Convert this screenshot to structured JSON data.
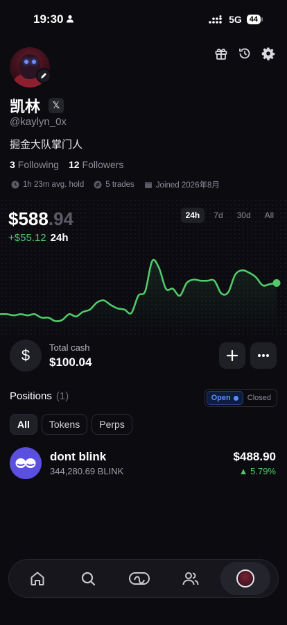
{
  "status_bar": {
    "time": "19:30",
    "network": "5G",
    "battery": "44"
  },
  "profile": {
    "name": "凯林",
    "handle": "@kaylyn_0x",
    "bio": "掘金大队掌门人",
    "following_count": "3",
    "following_label": "Following",
    "followers_count": "12",
    "followers_label": "Followers",
    "avg_hold": "1h 23m avg. hold",
    "trades": "5 trades",
    "joined": "Joined 2026年8月",
    "social_badge": "𝕏"
  },
  "top_icons": [
    "gift-icon",
    "history-icon",
    "settings-icon"
  ],
  "portfolio": {
    "balance_main": "$588",
    "balance_cents": ".94",
    "change": "+$55.12",
    "change_period": "24h",
    "ranges": [
      "24h",
      "7d",
      "30d",
      "All"
    ],
    "active_range": "24h",
    "accent_color": "#52c96a"
  },
  "chart_data": {
    "type": "line",
    "title": "",
    "xlabel": "",
    "ylabel": "",
    "x": [
      0,
      1,
      2,
      3,
      4,
      5,
      6,
      7,
      8,
      9,
      10,
      11,
      12,
      13,
      14,
      15,
      16,
      17,
      18,
      19,
      20,
      21,
      22,
      23,
      24,
      25,
      26,
      27,
      28,
      29,
      30,
      31,
      32,
      33,
      34,
      35,
      36,
      37,
      38,
      39,
      40
    ],
    "series": [
      {
        "values": [
          548,
          548,
          547,
          548,
          547,
          548,
          545,
          545,
          542,
          543,
          548,
          546,
          550,
          552,
          558,
          560,
          556,
          553,
          552,
          549,
          564,
          568,
          594,
          588,
          570,
          570,
          564,
          575,
          578,
          577,
          577,
          577,
          566,
          567,
          582,
          586,
          584,
          580,
          573,
          574,
          575
        ]
      }
    ],
    "ylim": [
      535,
      600
    ],
    "line_color": "#52c96a",
    "grid": false
  },
  "cash": {
    "label": "Total cash",
    "value": "$100.04",
    "add_icon": "plus-icon",
    "more_icon": "more-icon"
  },
  "positions": {
    "title": "Positions",
    "count": "(1)",
    "toggle": [
      "Open",
      "Closed"
    ],
    "filters": [
      "All",
      "Tokens",
      "Perps"
    ],
    "items": [
      {
        "name": "dont blink",
        "amount": "344,280.69 BLINK",
        "value": "$488.90",
        "change": "▲ 5.79%"
      }
    ]
  },
  "nav": [
    "home-icon",
    "search-icon",
    "trade-icon",
    "people-icon",
    "profile-avatar"
  ]
}
